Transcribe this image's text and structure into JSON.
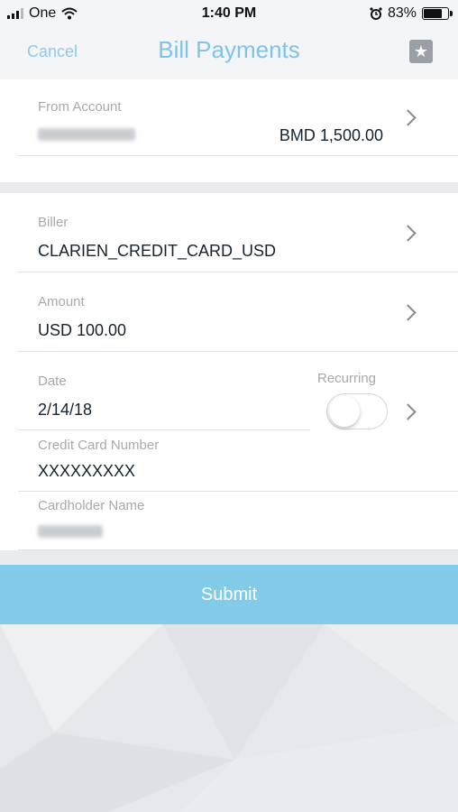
{
  "status_bar": {
    "carrier": "One",
    "time": "1:40 PM",
    "battery": "83%",
    "battery_level": 0.83
  },
  "nav": {
    "cancel_label": "Cancel",
    "title": "Bill Payments",
    "star_icon": "star-icon"
  },
  "from_account": {
    "label": "From Account",
    "balance": "BMD 1,500.00"
  },
  "biller": {
    "label": "Biller",
    "value": "CLARIEN_CREDIT_CARD_USD"
  },
  "amount": {
    "label": "Amount",
    "value": "USD 100.00"
  },
  "date": {
    "label": "Date",
    "value": "2/14/18"
  },
  "recurring": {
    "label": "Recurring",
    "on": false
  },
  "credit_card": {
    "label": "Credit Card Number",
    "value": "XXXXXXXXX"
  },
  "cardholder": {
    "label": "Cardholder Name"
  },
  "submit_label": "Submit",
  "colors": {
    "accent": "#7ec3e8",
    "submit_bg": "#82cbe9",
    "label": "#a9a9a9",
    "value": "#16232e"
  }
}
